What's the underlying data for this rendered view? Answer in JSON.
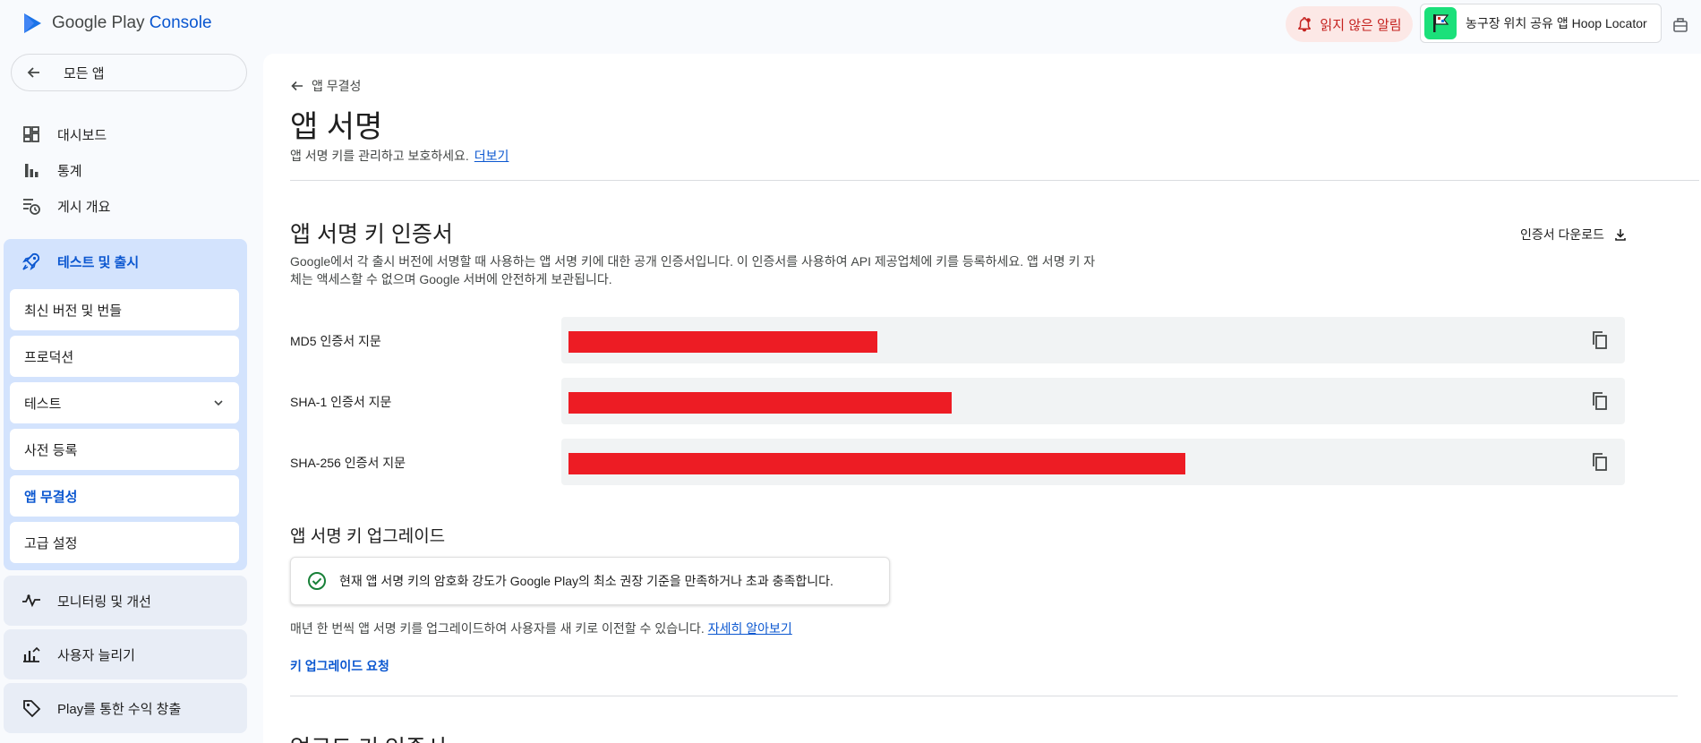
{
  "topbar": {
    "logo_text_main": "Google Play",
    "logo_text_accent": "Console",
    "notif_label": "읽지 않은 알림",
    "app_name": "농구장 위치 공유 앱 Hoop Locator"
  },
  "sidebar": {
    "all_apps_label": "모든 앱",
    "nav": [
      {
        "label": "대시보드",
        "icon": "dashboard-icon"
      },
      {
        "label": "통계",
        "icon": "bar-chart-icon"
      },
      {
        "label": "게시 개요",
        "icon": "publishing-overview-icon"
      }
    ],
    "release": {
      "label": "테스트 및 출시",
      "icon": "rocket-icon",
      "items": [
        {
          "label": "최신 버전 및 번들"
        },
        {
          "label": "프로덕션"
        },
        {
          "label": "테스트"
        },
        {
          "label": "사전 등록"
        },
        {
          "label": "앱 무결성"
        },
        {
          "label": "고급 설정"
        }
      ]
    },
    "groups": [
      {
        "label": "모니터링 및 개선",
        "icon": "monitoring-icon"
      },
      {
        "label": "사용자 늘리기",
        "icon": "grow-users-icon"
      },
      {
        "label": "Play를 통한 수익 창출",
        "icon": "tag-icon"
      }
    ]
  },
  "main": {
    "breadcrumb": "앱 무결성",
    "title": "앱 서명",
    "description": "앱 서명 키를 관리하고 보호하세요.",
    "learn_more": "더보기",
    "cert_section": {
      "title": "앱 서명 키 인증서",
      "download_label": "인증서 다운로드",
      "description": "Google에서 각 출시 버전에 서명할 때 사용하는 앱 서명 키에 대한 공개 인증서입니다. 이 인증서를 사용하여 API 제공업체에 키를 등록하세요. 앱 서명 키 자체는 액세스할 수 없으며 Google 서버에 안전하게 보관됩니다.",
      "fingerprints": [
        {
          "label": "MD5 인증서 지문",
          "redacted_fraction": 0.29
        },
        {
          "label": "SHA-1 인증서 지문",
          "redacted_fraction": 0.36
        },
        {
          "label": "SHA-256 인증서 지문",
          "redacted_fraction": 0.58
        }
      ],
      "redaction_color": "#ed1c24"
    },
    "upgrade_section": {
      "title": "앱 서명 키 업그레이드",
      "status": "현재 앱 서명 키의 암호화 강도가 Google Play의 최소 권장 기준을 만족하거나 초과 충족합니다.",
      "note": "매년 한 번씩 앱 서명 키를 업그레이드하여 사용자를 새 키로 이전할 수 있습니다.",
      "note_link": "자세히 알아보기",
      "request_label": "키 업그레이드 요청"
    },
    "next_section_title": "업로드 키 인증서"
  },
  "colors": {
    "accent": "#0b57d0",
    "sidebar_active_bg": "#d3e3fd",
    "success": "#188038",
    "notif_bg": "#fce8e6",
    "notif_text": "#c5221f"
  }
}
